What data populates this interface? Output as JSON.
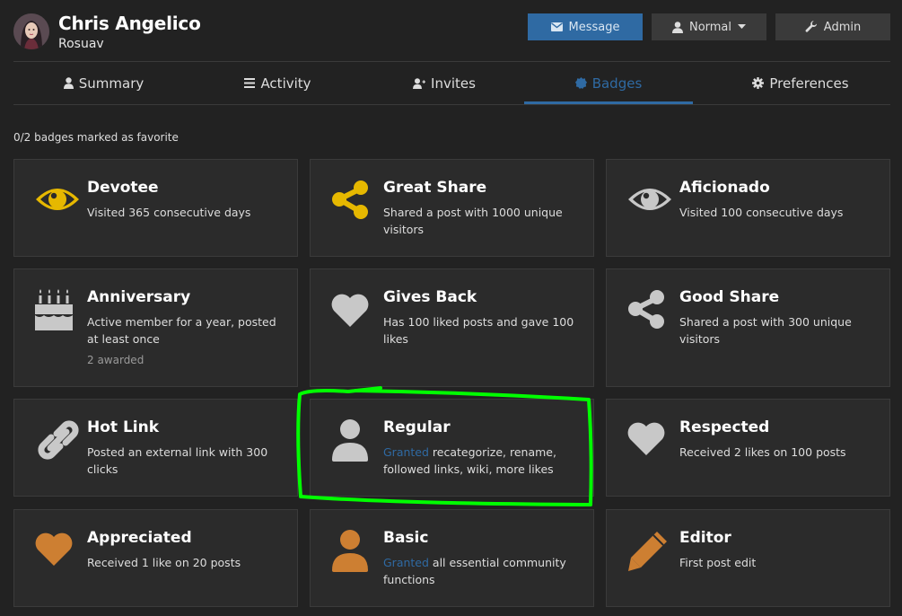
{
  "user": {
    "name": "Chris Angelico",
    "handle": "Rosuav"
  },
  "header_buttons": {
    "message": "Message",
    "normal": "Normal",
    "admin": "Admin"
  },
  "tabs": [
    {
      "label": "Summary",
      "icon": "user-icon"
    },
    {
      "label": "Activity",
      "icon": "list-icon"
    },
    {
      "label": "Invites",
      "icon": "user-plus-icon"
    },
    {
      "label": "Badges",
      "icon": "badge-icon",
      "active": true
    },
    {
      "label": "Preferences",
      "icon": "gear-icon"
    }
  ],
  "favorites_note": "0/2 badges marked as favorite",
  "colors": {
    "accent": "#2f6aa3",
    "gold": "#e6b800",
    "silver": "#c8c8c8",
    "bronze": "#cd7f32",
    "highlight": "#00ff00"
  },
  "badges": [
    {
      "title": "Devotee",
      "description": "Visited 365 consecutive days",
      "icon": "eye-icon",
      "tier": "gold"
    },
    {
      "title": "Great Share",
      "description": "Shared a post with 1000 unique visitors",
      "icon": "share-icon",
      "tier": "gold"
    },
    {
      "title": "Aficionado",
      "description": "Visited 100 consecutive days",
      "icon": "eye-icon",
      "tier": "silver"
    },
    {
      "title": "Anniversary",
      "description": "Active member for a year, posted at least once",
      "icon": "birthday-cake-icon",
      "tier": "silver",
      "awarded": "2 awarded"
    },
    {
      "title": "Gives Back",
      "description": "Has 100 liked posts and gave 100 likes",
      "icon": "heart-icon",
      "tier": "silver"
    },
    {
      "title": "Good Share",
      "description": "Shared a post with 300 unique visitors",
      "icon": "share-icon",
      "tier": "silver"
    },
    {
      "title": "Hot Link",
      "description": "Posted an external link with 300 clicks",
      "icon": "link-icon",
      "tier": "silver"
    },
    {
      "title": "Regular",
      "granted": "Granted",
      "description": "recategorize, rename, followed links, wiki, more likes",
      "icon": "user-icon",
      "tier": "silver"
    },
    {
      "title": "Respected",
      "description": "Received 2 likes on 100 posts",
      "icon": "heart-icon",
      "tier": "silver"
    },
    {
      "title": "Appreciated",
      "description": "Received 1 like on 20 posts",
      "icon": "heart-icon",
      "tier": "bronze"
    },
    {
      "title": "Basic",
      "granted": "Granted",
      "description": "all essential community functions",
      "icon": "user-icon",
      "tier": "bronze"
    },
    {
      "title": "Editor",
      "description": "First post edit",
      "icon": "pencil-icon",
      "tier": "bronze"
    }
  ]
}
